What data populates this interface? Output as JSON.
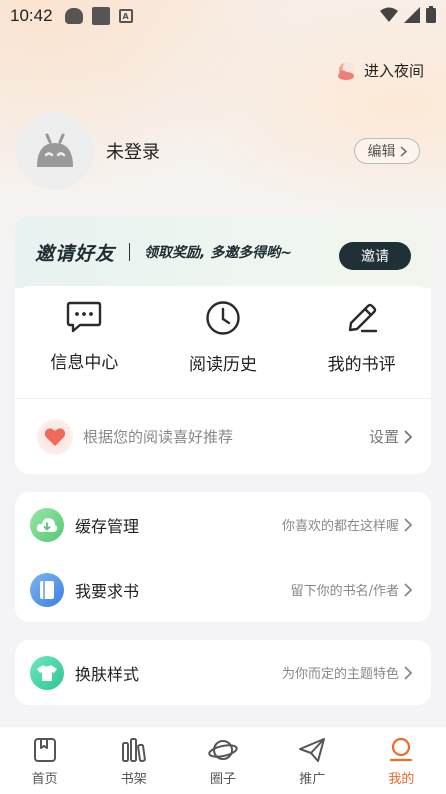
{
  "status_bar": {
    "time": "10:42",
    "notif_icon_letter": "A"
  },
  "night_mode": {
    "label": "进入夜间",
    "icon": "moon-cloud-icon"
  },
  "profile": {
    "login_text": "未登录",
    "edit_label": "编辑",
    "avatar_icon": "robot-avatar-icon"
  },
  "invite": {
    "title": "邀请好友",
    "subtitle": "领取奖励, 多邀多得哟~",
    "button": "邀请"
  },
  "quick_actions": [
    {
      "label": "信息中心",
      "icon": "message-icon"
    },
    {
      "label": "阅读历史",
      "icon": "clock-icon"
    },
    {
      "label": "我的书评",
      "icon": "pencil-icon"
    }
  ],
  "recommend": {
    "text": "根据您的阅读喜好推荐",
    "settings": "设置",
    "icon": "heart-icon"
  },
  "list_group_1": [
    {
      "title": "缓存管理",
      "hint": "你喜欢的都在这样喔",
      "icon": "cloud-download-icon",
      "color": "#6cd486"
    },
    {
      "title": "我要求书",
      "hint": "留下你的书名/作者",
      "icon": "book-icon",
      "color": "#4a8ee6"
    }
  ],
  "list_group_2": [
    {
      "title": "换肤样式",
      "hint": "为你而定的主题特色",
      "icon": "shirt-icon",
      "color": "#3ecf9e"
    }
  ],
  "tabs": [
    {
      "label": "首页",
      "icon": "home-book-icon",
      "active": false
    },
    {
      "label": "书架",
      "icon": "bookshelf-icon",
      "active": false
    },
    {
      "label": "圈子",
      "icon": "planet-icon",
      "active": false
    },
    {
      "label": "推广",
      "icon": "paper-plane-icon",
      "active": false
    },
    {
      "label": "我的",
      "icon": "profile-icon",
      "active": true
    }
  ],
  "colors": {
    "accent": "#f06a2a",
    "invite_button": "#1f3136"
  }
}
